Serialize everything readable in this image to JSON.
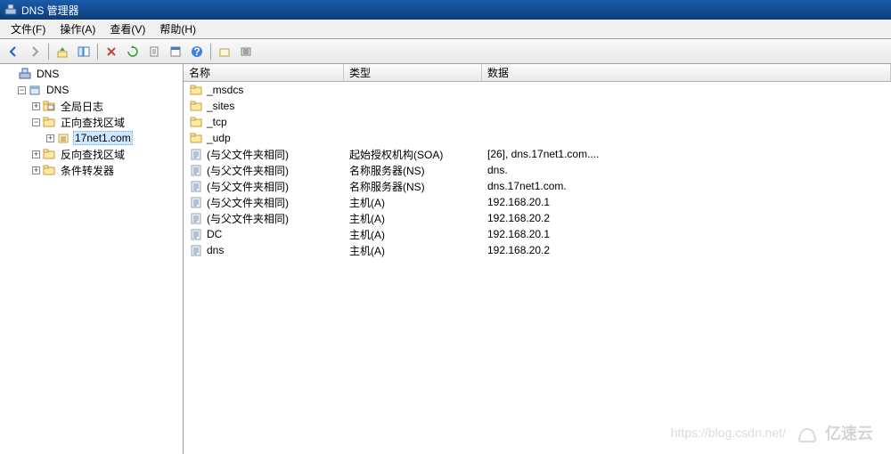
{
  "window": {
    "title": "DNS 管理器"
  },
  "menu": {
    "file": "文件(F)",
    "action": "操作(A)",
    "view": "查看(V)",
    "help": "帮助(H)"
  },
  "tree": {
    "root": "DNS",
    "server": "DNS",
    "global_log": "全局日志",
    "forward_zone": "正向查找区域",
    "domain": "17net1.com",
    "reverse_zone": "反向查找区域",
    "conditional_forwarder": "条件转发器"
  },
  "columns": {
    "name": "名称",
    "type": "类型",
    "data": "数据"
  },
  "rows": [
    {
      "icon": "folder",
      "name": "_msdcs",
      "type": "",
      "data": ""
    },
    {
      "icon": "folder",
      "name": "_sites",
      "type": "",
      "data": ""
    },
    {
      "icon": "folder",
      "name": "_tcp",
      "type": "",
      "data": ""
    },
    {
      "icon": "folder",
      "name": "_udp",
      "type": "",
      "data": ""
    },
    {
      "icon": "record",
      "name": "(与父文件夹相同)",
      "type": "起始授权机构(SOA)",
      "data": "[26], dns.17net1.com...."
    },
    {
      "icon": "record",
      "name": "(与父文件夹相同)",
      "type": "名称服务器(NS)",
      "data": "dns."
    },
    {
      "icon": "record",
      "name": "(与父文件夹相同)",
      "type": "名称服务器(NS)",
      "data": "dns.17net1.com."
    },
    {
      "icon": "record",
      "name": "(与父文件夹相同)",
      "type": "主机(A)",
      "data": "192.168.20.1"
    },
    {
      "icon": "record",
      "name": "(与父文件夹相同)",
      "type": "主机(A)",
      "data": "192.168.20.2"
    },
    {
      "icon": "record",
      "name": "DC",
      "type": "主机(A)",
      "data": "192.168.20.1"
    },
    {
      "icon": "record",
      "name": "dns",
      "type": "主机(A)",
      "data": "192.168.20.2"
    }
  ],
  "watermark": {
    "url": "https://blog.csdn.net/",
    "brand": "亿速云"
  }
}
